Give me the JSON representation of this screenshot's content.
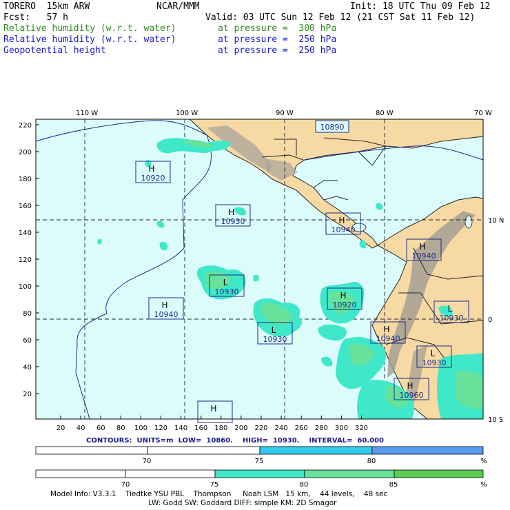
{
  "header": {
    "model": "TORERO  15km ARW",
    "org": "NCAR/MMM",
    "init": "Init: 18 UTC Thu 09 Feb 12",
    "fcst": "Fcst:   57 h",
    "valid": "Valid: 03 UTC Sun 12 Feb 12 (21 CST Sat 11 Feb 12)",
    "fields": [
      {
        "name": "Relative humidity (w.r.t. water)",
        "level": "at pressure =  300 hPa",
        "color": "#2e8b1e"
      },
      {
        "name": "Relative humidity (w.r.t. water)",
        "level": "at pressure =  250 hPa",
        "color": "#1a1ad0"
      },
      {
        "name": "Geopotential height",
        "level": "at pressure =  250 hPa",
        "color": "#1a1ad0"
      }
    ]
  },
  "map": {
    "lon_labels": [
      "110 W",
      "100 W",
      "90 W",
      "80 W",
      "70 W"
    ],
    "lat_labels": [
      "10 N",
      "0",
      "10 S"
    ],
    "x_ticks": [
      "20",
      "40",
      "60",
      "80",
      "100",
      "120",
      "140",
      "160",
      "180",
      "200",
      "220",
      "240",
      "260",
      "280",
      "300",
      "320"
    ],
    "y_ticks": [
      "220",
      "200",
      "180",
      "160",
      "140",
      "120",
      "100",
      "80",
      "60",
      "40",
      "20"
    ],
    "centers": [
      {
        "type": "H",
        "value": "10890"
      },
      {
        "type": "H",
        "value": "10920"
      },
      {
        "type": "H",
        "value": "10930"
      },
      {
        "type": "H",
        "value": "10940"
      },
      {
        "type": "H",
        "value": "10940"
      },
      {
        "type": "L",
        "value": "10930"
      },
      {
        "type": "H",
        "value": "10940"
      },
      {
        "type": "H",
        "value": "10920"
      },
      {
        "type": "L",
        "value": "10930"
      },
      {
        "type": "L",
        "value": "10930"
      },
      {
        "type": "H",
        "value": "10940"
      },
      {
        "type": "L",
        "value": "10930"
      },
      {
        "type": "H",
        "value": "10960"
      },
      {
        "type": "H",
        "value": ""
      }
    ]
  },
  "contours_line": "CONTOURS:  UNITS=m  LOW=  10860.    HIGH=  10930.    INTERVAL=  60.000",
  "colorbar_250": {
    "labels": [
      "70",
      "75",
      "80",
      "%"
    ],
    "colors": [
      "#ffffff",
      "#ffffff",
      "#33ccf0",
      "#5a9bf0"
    ]
  },
  "colorbar_300": {
    "labels": [
      "70",
      "75",
      "80",
      "85",
      "%"
    ],
    "colors": [
      "#ffffff",
      "#ffffff",
      "#3ee8c8",
      "#66e29a",
      "#5ccc55"
    ]
  },
  "footer": {
    "line1": "Model Info: V3.3.1    Tiedtke YSU PBL    Thompson     Noah LSM   15 km,    44 levels,    48 sec",
    "line2": "LW: Godd SW: Goddard DIFF: simple KM: 2D Smagor"
  }
}
